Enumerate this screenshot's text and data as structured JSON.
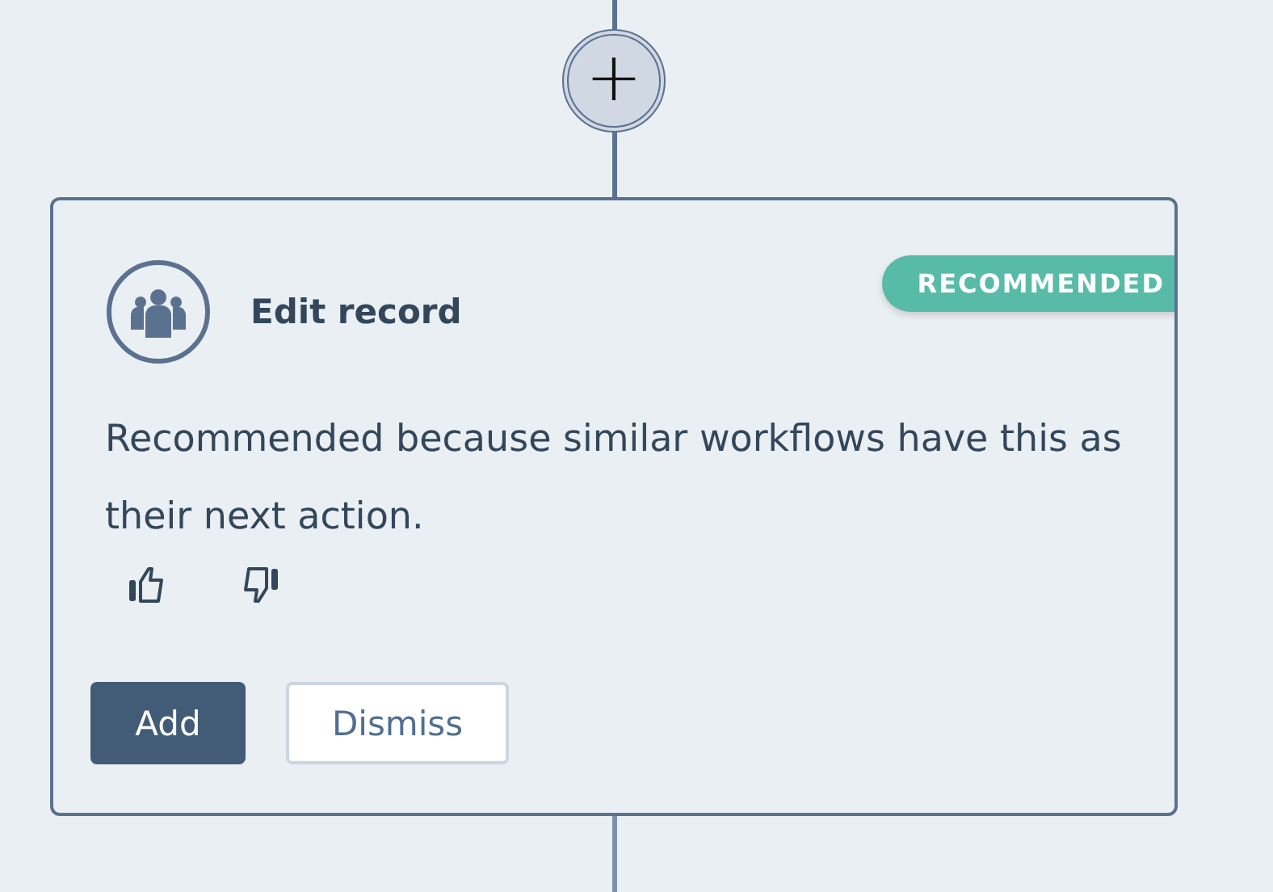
{
  "add_step_button": {
    "label": "+"
  },
  "card": {
    "title": "Edit record",
    "badge": "RECOMMENDED",
    "description": "Recommended because similar workflows have this as their next action.",
    "buttons": [
      {
        "label": "Add",
        "kind": "primary"
      },
      {
        "label": "Dismiss",
        "kind": "secondary"
      }
    ]
  }
}
